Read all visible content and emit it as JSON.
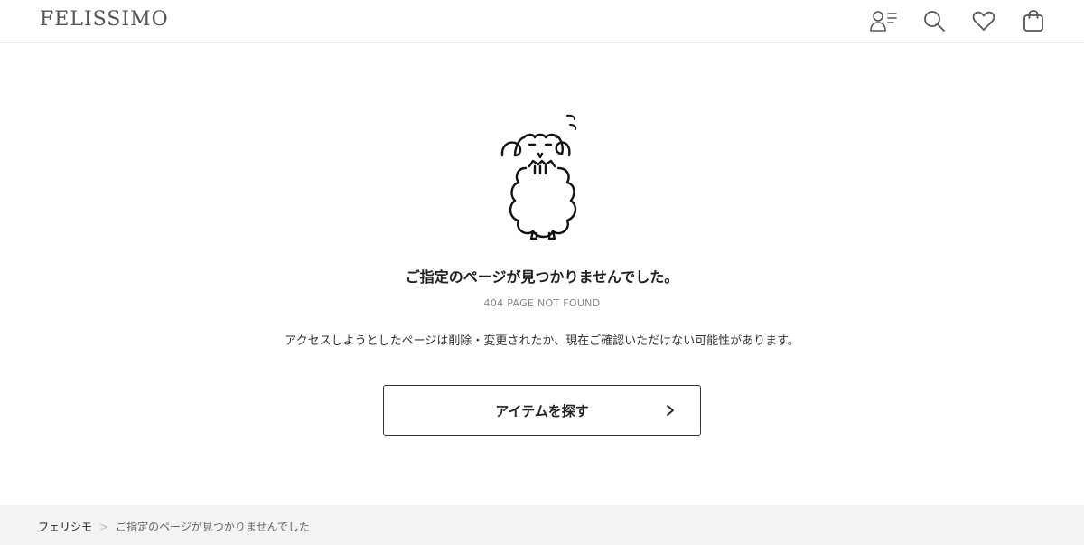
{
  "header": {
    "logo_text": "FELISSIMO",
    "icons": [
      "account-menu-icon",
      "search-icon",
      "heart-icon",
      "shopping-bag-icon"
    ]
  },
  "main": {
    "mascot": "sheep-mascot-illustration",
    "title": "ご指定のページが見つかりませんでした。",
    "subtitle": "404 PAGE NOT FOUND",
    "description": "アクセスしようとしたページは削除・変更されたか、現在ご確認いただけない可能性があります。",
    "cta_label": "アイテムを探す"
  },
  "breadcrumb": {
    "home": "フェリシモ",
    "separator": ">",
    "current": "ご指定のページが見つかりませんでした"
  },
  "colors": {
    "text": "#222222",
    "muted": "#888888",
    "icon": "#555555",
    "footer_bg": "#f3f3f3",
    "button_border": "#333333"
  }
}
